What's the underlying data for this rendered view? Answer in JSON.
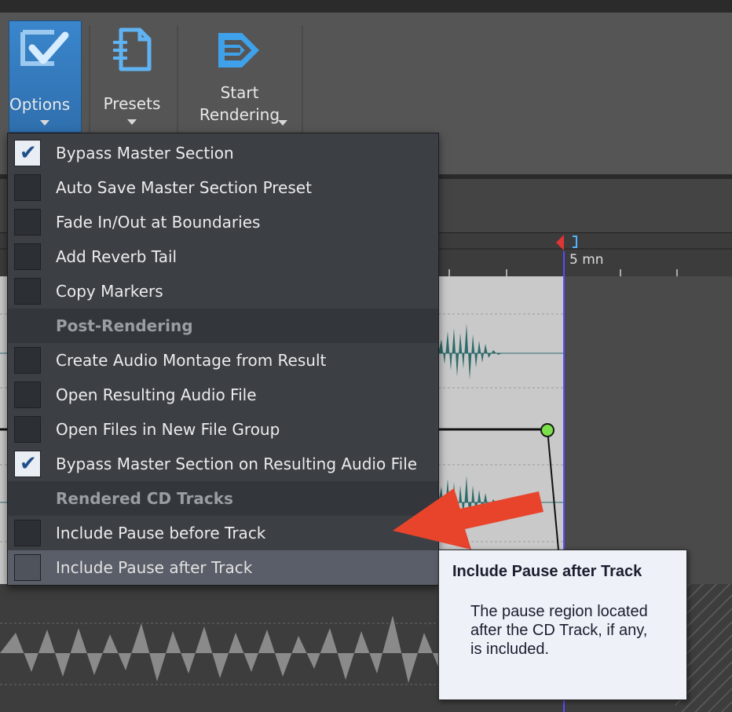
{
  "toolbar": {
    "options_label": "Options",
    "presets_label": "Presets",
    "start_rendering_line1": "Start",
    "start_rendering_line2": "Rendering"
  },
  "ruler": {
    "time_label": "5 mn"
  },
  "menu": {
    "items": [
      {
        "label": "Bypass Master Section",
        "checked": true
      },
      {
        "label": "Auto Save Master Section Preset",
        "checked": false
      },
      {
        "label": "Fade In/Out at Boundaries",
        "checked": false
      },
      {
        "label": "Add Reverb Tail",
        "checked": false
      },
      {
        "label": "Copy Markers",
        "checked": false
      },
      {
        "label": "Post-Rendering",
        "header": true
      },
      {
        "label": "Create Audio Montage from Result",
        "checked": false
      },
      {
        "label": "Open Resulting Audio File",
        "checked": false
      },
      {
        "label": "Open Files in New File Group",
        "checked": false
      },
      {
        "label": "Bypass Master Section on Resulting Audio File",
        "checked": true
      },
      {
        "label": "Rendered CD Tracks",
        "header": true
      },
      {
        "label": "Include Pause before Track",
        "checked": false
      },
      {
        "label": "Include Pause after Track",
        "checked": false,
        "hovered": true
      }
    ]
  },
  "tooltip": {
    "title": "Include Pause after Track",
    "body": "The pause region located after the CD Track, if any, is included."
  },
  "colors": {
    "accent": "#3a86cc",
    "arrow": "#e8442c",
    "envelope_point": "#7be04a",
    "cursor": "#5a4cff",
    "waveform": "#2f6b6b"
  }
}
